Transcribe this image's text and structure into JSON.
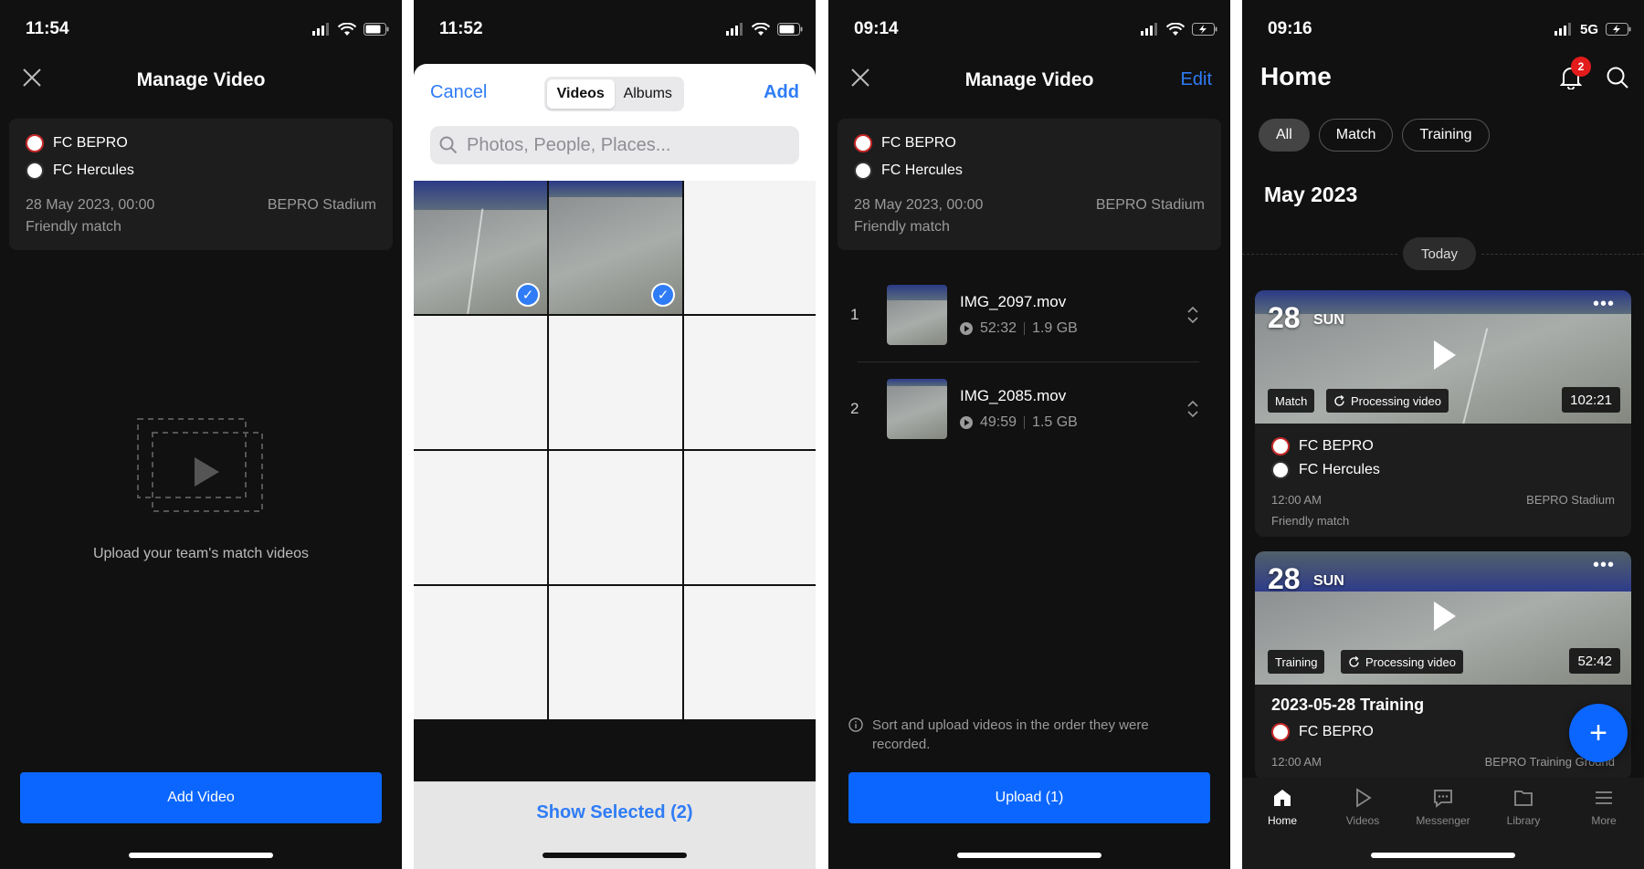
{
  "screen1": {
    "time": "11:54",
    "title": "Manage Video",
    "team1": "FC BEPRO",
    "team2": "FC Hercules",
    "datetime": "28 May 2023, 00:00",
    "venue": "BEPRO Stadium",
    "match_type": "Friendly match",
    "empty_text": "Upload your team's match videos",
    "button": "Add Video"
  },
  "screen2": {
    "time": "11:52",
    "cancel": "Cancel",
    "seg_videos": "Videos",
    "seg_albums": "Albums",
    "add": "Add",
    "search_placeholder": "Photos, People, Places...",
    "show_selected": "Show Selected (2)"
  },
  "screen3": {
    "time": "09:14",
    "title": "Manage Video",
    "edit": "Edit",
    "team1": "FC BEPRO",
    "team2": "FC Hercules",
    "datetime": "28 May 2023, 00:00",
    "venue": "BEPRO Stadium",
    "match_type": "Friendly match",
    "videos": [
      {
        "index": "1",
        "name": "IMG_2097.mov",
        "duration": "52:32",
        "size": "1.9 GB"
      },
      {
        "index": "2",
        "name": "IMG_2085.mov",
        "duration": "49:59",
        "size": "1.5 GB"
      }
    ],
    "note": "Sort and upload videos in the order they were recorded.",
    "button": "Upload (1)"
  },
  "screen4": {
    "time": "09:16",
    "network": "5G",
    "title": "Home",
    "notif_count": "2",
    "filters": [
      "All",
      "Match",
      "Training"
    ],
    "month": "May 2023",
    "today": "Today",
    "cards": [
      {
        "day": "28",
        "dow": "SUN",
        "tag": "Match",
        "status": "Processing video",
        "duration": "102:21",
        "team1": "FC BEPRO",
        "team2": "FC Hercules",
        "time": "12:00 AM",
        "venue": "BEPRO Stadium",
        "type": "Friendly match"
      },
      {
        "day": "28",
        "dow": "SUN",
        "tag": "Training",
        "status": "Processing video",
        "duration": "52:42",
        "title": "2023-05-28 Training",
        "team1": "FC BEPRO",
        "time": "12:00 AM",
        "venue": "BEPRO Training Ground"
      }
    ],
    "tabs": [
      "Home",
      "Videos",
      "Messenger",
      "Library",
      "More"
    ]
  },
  "colors": {
    "accent": "#0a66ff",
    "link": "#2f7cf6",
    "dark_bg": "#111111",
    "card_bg": "#1d1d1d",
    "badge_red": "#e41b1b"
  }
}
